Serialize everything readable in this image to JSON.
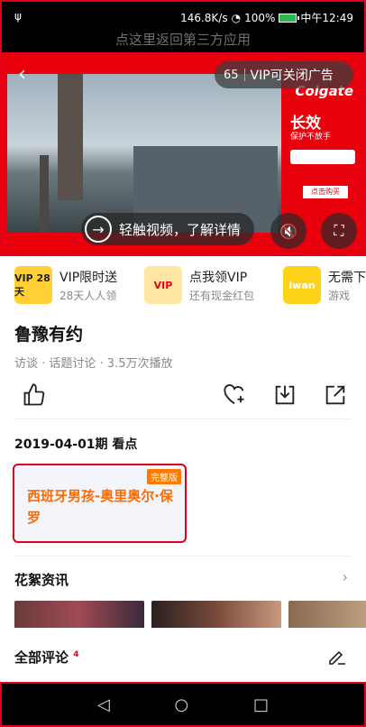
{
  "status": {
    "speed": "146.8K/s",
    "battery_percent": "100%",
    "time": "中午12:49"
  },
  "return_bar": {
    "text": "点这里返回第三方应用"
  },
  "player": {
    "ad_countdown": "65",
    "vip_close_ad": "VIP可关闭广告",
    "touch_hint": "轻触视频，了解详情",
    "ad_brand": "Colgate",
    "ad_slogan": "长效",
    "ad_sub": "保护不放手",
    "ad_buy": "点击购买"
  },
  "promos": [
    {
      "thumb": "VIP 28天",
      "title": "VIP限时送",
      "subtitle": "28天人人领",
      "color": "#222",
      "thumb_bg": "#ffcf33"
    },
    {
      "thumb": "VIP",
      "title": "点我领VIP",
      "subtitle": "还有现金红包",
      "color": "#e0001b",
      "thumb_bg": "#ffe7a3"
    },
    {
      "thumb": "iwan",
      "title": "无需下",
      "subtitle": "游戏",
      "color": "#fff",
      "thumb_bg": "#ffd21a"
    }
  ],
  "video": {
    "title": "鲁豫有约",
    "meta": "访谈 · 话题讨论 · 3.5万次播放"
  },
  "episodes": {
    "heading": "2019-04-01期 看点",
    "items": [
      {
        "name": "西班牙男孩-奥里奥尔·保罗",
        "badge": "完整版"
      }
    ]
  },
  "highlights": {
    "title": "花絮资讯"
  },
  "comments": {
    "label": "全部评论",
    "count": "4"
  }
}
